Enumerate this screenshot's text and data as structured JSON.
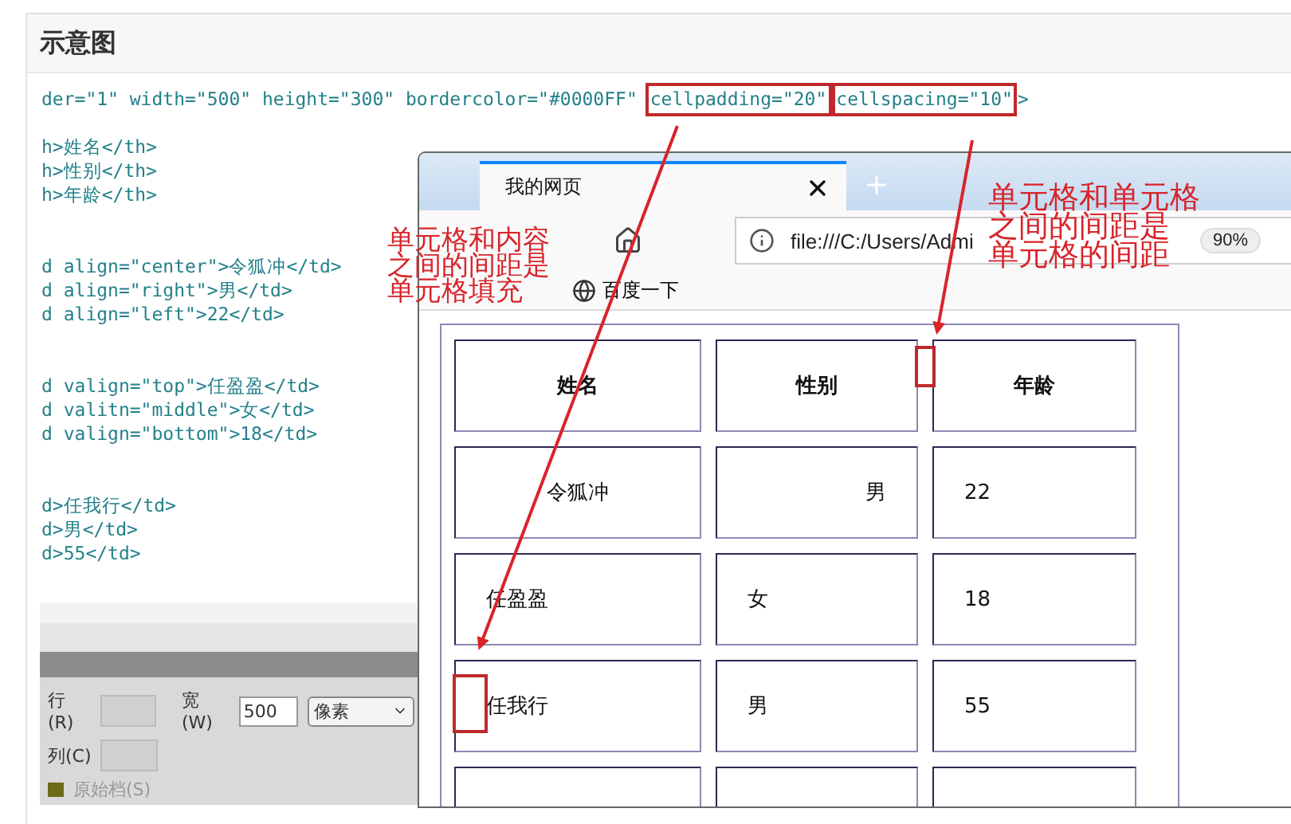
{
  "panel": {
    "title": "示意图"
  },
  "first_line": {
    "prefix": "der=\"1\" width=\"500\" height=\"300\" bordercolor=\"#0000FF\"",
    "highlights": [
      "cellpadding=\"20\"",
      "cellspacing=\"10\""
    ],
    "suffix": ">"
  },
  "code_blocks": [
    [
      "h>姓名</th>",
      "h>性别</th>",
      "h>年龄</th>"
    ],
    [
      "d align=\"center\">令狐冲</td>",
      "d align=\"right\">男</td>",
      "d align=\"left\">22</td>"
    ],
    [
      "d valign=\"top\">任盈盈</td>",
      "d valitn=\"middle\">女</td>",
      "d valign=\"bottom\">18</td>"
    ],
    [
      "d>任我行</td>",
      "d>男</td>",
      "d>55</td>"
    ]
  ],
  "properties": {
    "rows_label": "行(R)",
    "cols_label": "列(C)",
    "width_label": "宽(W)",
    "width_value": "500",
    "unit": "像素",
    "source_label": "原始档(S)"
  },
  "browser": {
    "tabs": [
      {
        "label": "我的网页",
        "selected": true
      }
    ],
    "url": "file:///C:/Users/Admi",
    "zoom": "90%",
    "bookmarks": [
      "百度一下"
    ]
  },
  "table": {
    "header": [
      "姓名",
      "性别",
      "年龄"
    ],
    "rows": [
      [
        {
          "text": "令狐冲",
          "kind": "center"
        },
        {
          "text": "男",
          "kind": "right"
        },
        {
          "text": "22",
          "kind": "left"
        }
      ],
      [
        {
          "text": "任盈盈",
          "kind": "left"
        },
        {
          "text": "女",
          "kind": "left"
        },
        {
          "text": "18",
          "kind": "left"
        }
      ],
      [
        {
          "text": "任我行",
          "kind": "left"
        },
        {
          "text": "男",
          "kind": "left"
        },
        {
          "text": "55",
          "kind": "left"
        }
      ]
    ]
  },
  "annotations": [
    {
      "lines": [
        "单元格和内容",
        "之间的间距是",
        "单元格填充"
      ]
    },
    {
      "lines": [
        "单元格和单元格",
        "之间的间距是",
        "单元格的间距"
      ]
    }
  ]
}
